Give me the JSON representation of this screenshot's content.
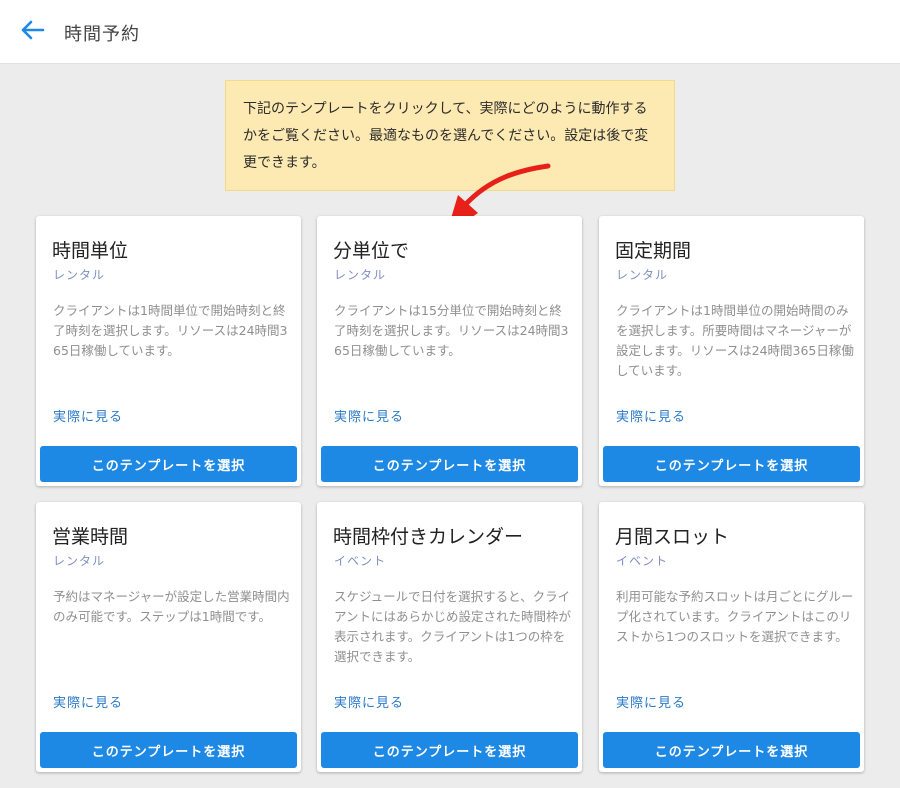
{
  "header": {
    "title": "時間予約",
    "back_icon": "arrow-left-icon",
    "accent_color": "#1e88e5"
  },
  "hint": {
    "text": "下記のテンプレートをクリックして、実際にどのように動作するかをご覧ください。最適なものを選んでください。設定は後で変更できます。",
    "background": "#fde9b2",
    "arrow_color": "#e8201a"
  },
  "cards": [
    {
      "title": "時間単位",
      "category": "レンタル",
      "description": "クライアントは1時間単位で開始時刻と終了時刻を選択します。リソースは24時間365日稼働しています。",
      "link": "実際に見る",
      "button": "このテンプレートを選択"
    },
    {
      "title": "分単位で",
      "category": "レンタル",
      "description": "クライアントは15分単位で開始時刻と終了時刻を選択します。リソースは24時間365日稼働しています。",
      "link": "実際に見る",
      "button": "このテンプレートを選択"
    },
    {
      "title": "固定期間",
      "category": "レンタル",
      "description": "クライアントは1時間単位の開始時間のみを選択します。所要時間はマネージャーが設定します。リソースは24時間365日稼働しています。",
      "link": "実際に見る",
      "button": "このテンプレートを選択"
    },
    {
      "title": "営業時間",
      "category": "レンタル",
      "description": "予約はマネージャーが設定した営業時間内のみ可能です。ステップは1時間です。",
      "link": "実際に見る",
      "button": "このテンプレートを選択"
    },
    {
      "title": "時間枠付きカレンダー",
      "category": "イベント",
      "description": "スケジュールで日付を選択すると、クライアントにはあらかじめ設定された時間枠が表示されます。クライアントは1つの枠を選択できます。",
      "link": "実際に見る",
      "button": "このテンプレートを選択"
    },
    {
      "title": "月間スロット",
      "category": "イベント",
      "description": "利用可能な予約スロットは月ごとにグループ化されています。クライアントはこのリストから1つのスロットを選択できます。",
      "link": "実際に見る",
      "button": "このテンプレートを選択"
    }
  ]
}
